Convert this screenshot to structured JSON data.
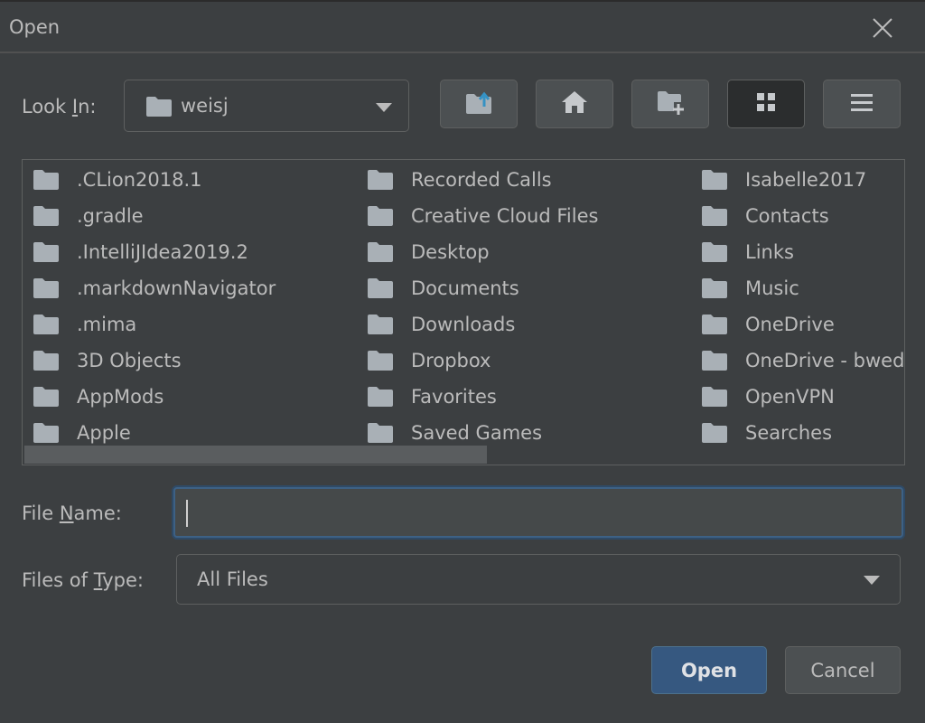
{
  "dialog": {
    "title": "Open",
    "look_in_label_pre": "Look ",
    "look_in_label_mnemonic": "I",
    "look_in_label_post": "n:",
    "look_in_value": "weisj",
    "file_name_label_pre": "File ",
    "file_name_label_mnemonic": "N",
    "file_name_label_post": "ame:",
    "file_name_value": "",
    "files_of_type_label_pre": "Files of ",
    "files_of_type_label_mnemonic": "T",
    "files_of_type_label_post": "ype:",
    "files_of_type_value": "All Files",
    "open_button": "Open",
    "cancel_button": "Cancel"
  },
  "toolbar": {
    "buttons": [
      "up-one-level-icon",
      "home-icon",
      "new-folder-icon",
      "list-view-icon",
      "details-view-icon"
    ],
    "selected": "list-view-icon"
  },
  "files": {
    "column1": [
      ".CLion2018.1",
      ".gradle",
      ".IntelliJIdea2019.2",
      ".markdownNavigator",
      ".mima",
      "3D Objects",
      "AppMods",
      "Apple"
    ],
    "column2": [
      "Recorded Calls",
      "Creative Cloud Files",
      "Desktop",
      "Documents",
      "Downloads",
      "Dropbox",
      "Favorites",
      "Saved Games"
    ],
    "column3": [
      "Isabelle2017",
      "Contacts",
      "Links",
      "Music",
      "OneDrive",
      "OneDrive - bwedu",
      "OpenVPN",
      "Searches"
    ]
  },
  "colors": {
    "background": "#3c3f41",
    "text": "#bbbbbb",
    "folder_icon": "#a9b0b6",
    "accent": "#365880",
    "focus_border": "#3d6185"
  }
}
